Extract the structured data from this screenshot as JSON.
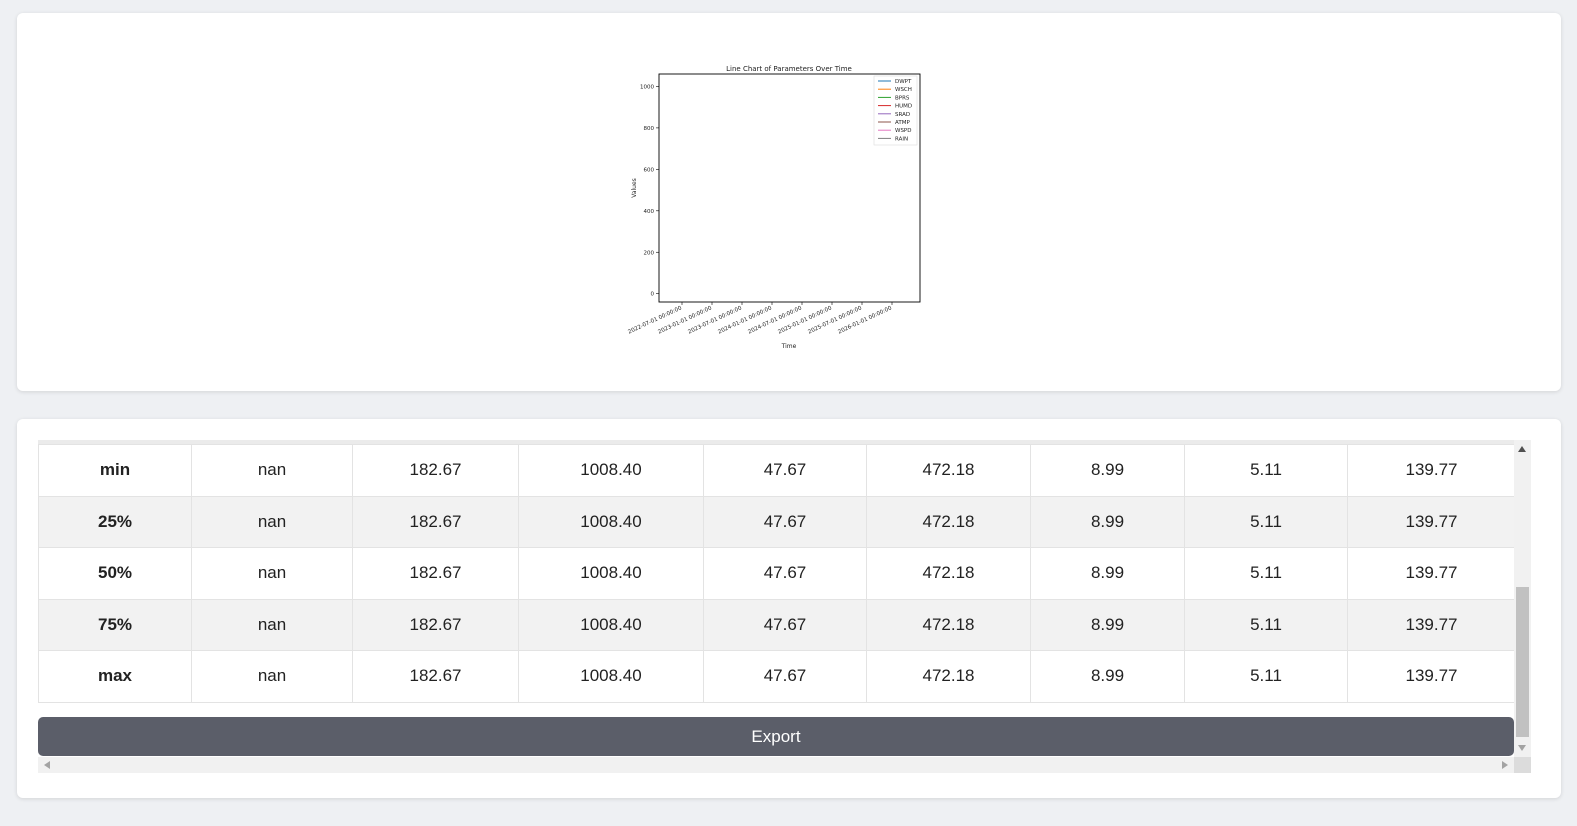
{
  "chart_data": {
    "type": "line",
    "title": "Line Chart of Parameters Over Time",
    "xlabel": "Time",
    "ylabel": "Values",
    "ylim": [
      -40,
      1060
    ],
    "yticks": [
      "0",
      "200",
      "400",
      "600",
      "800",
      "1000"
    ],
    "xticks": [
      "2022-07-01 00:00:00",
      "2023-01-01 00:00:00",
      "2023-07-01 00:00:00",
      "2024-01-01 00:00:00",
      "2024-07-01 00:00:00",
      "2025-01-01 00:00:00",
      "2025-07-01 00:00:00",
      "2026-01-01 00:00:00"
    ],
    "grid": false,
    "legend_position": "top-right",
    "series": [
      {
        "name": "DWPT",
        "color": "#1f77b4",
        "values": []
      },
      {
        "name": "WSCH",
        "color": "#ff7f0e",
        "values": []
      },
      {
        "name": "BPRS",
        "color": "#2ca02c",
        "values": []
      },
      {
        "name": "HUMD",
        "color": "#d62728",
        "values": []
      },
      {
        "name": "SRAD",
        "color": "#9467bd",
        "values": []
      },
      {
        "name": "ATMP",
        "color": "#8c564b",
        "values": []
      },
      {
        "name": "WSPD",
        "color": "#e377c2",
        "values": []
      },
      {
        "name": "RAIN",
        "color": "#7f7f7f",
        "values": []
      }
    ]
  },
  "table": {
    "rows": [
      {
        "label": "min",
        "cells": [
          "nan",
          "182.67",
          "1008.40",
          "47.67",
          "472.18",
          "8.99",
          "5.11",
          "139.77"
        ]
      },
      {
        "label": "25%",
        "cells": [
          "nan",
          "182.67",
          "1008.40",
          "47.67",
          "472.18",
          "8.99",
          "5.11",
          "139.77"
        ]
      },
      {
        "label": "50%",
        "cells": [
          "nan",
          "182.67",
          "1008.40",
          "47.67",
          "472.18",
          "8.99",
          "5.11",
          "139.77"
        ]
      },
      {
        "label": "75%",
        "cells": [
          "nan",
          "182.67",
          "1008.40",
          "47.67",
          "472.18",
          "8.99",
          "5.11",
          "139.77"
        ]
      },
      {
        "label": "max",
        "cells": [
          "nan",
          "182.67",
          "1008.40",
          "47.67",
          "472.18",
          "8.99",
          "5.11",
          "139.77"
        ]
      }
    ]
  },
  "export_button": {
    "label": "Export",
    "color": "#5b5e69"
  }
}
